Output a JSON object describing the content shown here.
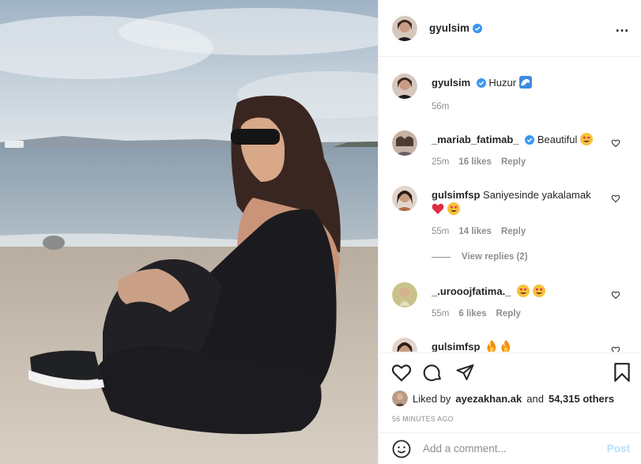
{
  "post": {
    "author": "gyulsim",
    "caption_user": "gyulsim",
    "caption_text": "Huzur",
    "caption_emoji": "wave-emoji",
    "caption_time": "56m",
    "more_icon": "…"
  },
  "comments": [
    {
      "user": "_mariab_fatimab_",
      "verified": true,
      "text": "Beautiful",
      "emojis": [
        "heart-eyes-emoji"
      ],
      "time": "25m",
      "likes": "16 likes",
      "reply": "Reply"
    },
    {
      "user": "gulsimfsp",
      "verified": false,
      "text": "Saniyesinde yakalamak",
      "emojis": [
        "red-heart-emoji",
        "heart-eyes-emoji"
      ],
      "time": "55m",
      "likes": "14 likes",
      "reply": "Reply",
      "view_replies": "View replies (2)"
    },
    {
      "user": "_.urooojfatima._",
      "verified": false,
      "text": "",
      "emojis": [
        "heart-eyes-emoji",
        "heart-eyes-emoji"
      ],
      "time": "55m",
      "likes": "6 likes",
      "reply": "Reply"
    },
    {
      "user": "gulsimfsp",
      "verified": false,
      "text": "",
      "emojis": [
        "fire-emoji",
        "fire-emoji"
      ]
    }
  ],
  "likes": {
    "prefix": "Liked by",
    "user": "ayezakhan.ak",
    "and": "and",
    "count": "54,315 others"
  },
  "timestamp": "56 MINUTES AGO",
  "comment_box": {
    "placeholder": "Add a comment...",
    "post_label": "Post"
  },
  "colors": {
    "verified": "#3897f0",
    "secondary_text": "#8e8e8e",
    "post_disabled": "#b2dffc"
  }
}
